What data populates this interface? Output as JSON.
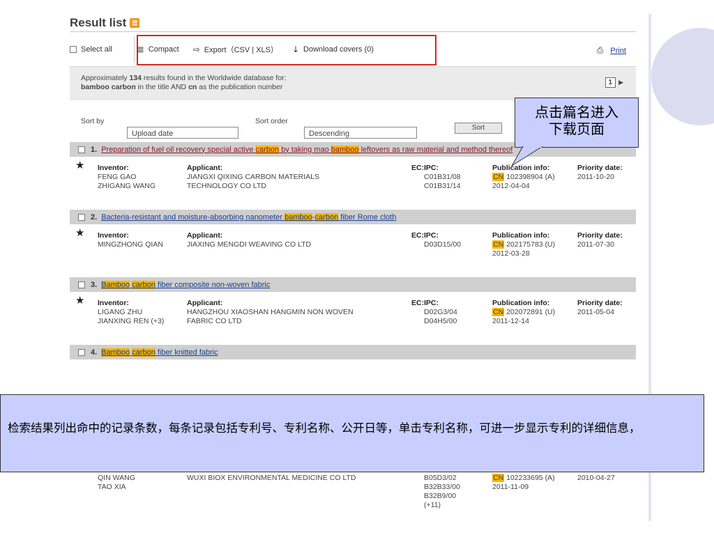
{
  "header": {
    "title": "Result list",
    "rss_icon": "rss-icon"
  },
  "toolbar": {
    "select_all": "Select all",
    "compact": "Compact",
    "export": "Export（CSV | XLS）",
    "download_covers": "Download covers (0)",
    "print": "Print"
  },
  "info": {
    "line1_pre": "Approximately ",
    "count": "134",
    "line1_post": " results found in the Worldwide database for:",
    "line2_term1": "bamboo carbon",
    "line2_mid": " in the title AND ",
    "line2_term2": "cn",
    "line2_post": " as the publication number",
    "page": "1"
  },
  "sort": {
    "sort_by_label": "Sort by",
    "sort_by_value": "Upload date",
    "sort_order_label": "Sort order",
    "sort_order_value": "Descending",
    "sort_button": "Sort"
  },
  "callout": {
    "line1": "点击篇名进入",
    "line2": "下载页面"
  },
  "labels": {
    "inventor": "Inventor:",
    "applicant": "Applicant:",
    "ec": "EC:",
    "ipc": "IPC:",
    "publication": "Publication info:",
    "priority": "Priority date:"
  },
  "results": [
    {
      "num": "1.",
      "title_a": "Preparation of fuel oil recovery special active ",
      "title_b": "carbon",
      "title_c": " by taking mao ",
      "title_d": "bamboo",
      "title_e": " leftovers as raw material and method thereof",
      "inventor1": "FENG GAO",
      "inventor2": "ZHIGANG WANG",
      "applicant1": "JIANGXI QIXING CARBON MATERIALS",
      "applicant2": "TECHNOLOGY CO LTD",
      "ipc1": "C01B31/08",
      "ipc2": "C01B31/14",
      "pub_cn": "CN",
      "pub_no": " 102398904 (A)",
      "pub_date": "2012-04-04",
      "priority": "2011-10-20"
    },
    {
      "num": "2.",
      "title_a": "Bacteria-resistant and moisture-absorbing nanometer ",
      "title_b": "bamboo",
      "title_c": "-",
      "title_d": "carbon",
      "title_e": " fiber Rome cloth",
      "inventor1": "MINGZHONG QIAN",
      "inventor2": "",
      "applicant1": "JIAXING MENGDI WEAVING CO LTD",
      "applicant2": "",
      "ipc1": "D03D15/00",
      "ipc2": "",
      "pub_cn": "CN",
      "pub_no": " 202175783 (U)",
      "pub_date": "2012-03-28",
      "priority": "2011-07-30"
    },
    {
      "num": "3.",
      "title_a": "",
      "title_b": "Bamboo",
      "title_c": " ",
      "title_d": "carbon",
      "title_e": " fiber composite non-woven fabric",
      "inventor1": "LIGANG ZHU",
      "inventor2": "JIANXING REN (+3)",
      "applicant1": "HANGZHOU XIAOSHAN HANGMIN NON WOVEN",
      "applicant2": "FABRIC CO LTD",
      "ipc1": "D02G3/04",
      "ipc2": "D04H5/00",
      "pub_cn": "CN",
      "pub_no": " 202072891 (U)",
      "pub_date": "2011-12-14",
      "priority": "2011-05-04"
    },
    {
      "num": "4.",
      "title_a": "",
      "title_b": "Bamboo",
      "title_c": " ",
      "title_d": "carbon",
      "title_e": " fiber knitted fabric"
    }
  ],
  "overlay": {
    "text": "检索结果列出命中的记录条数，每条记录包括专利号、专利名称、公开日等，单击专利名称，可进一步显示专利的详细信息，"
  },
  "bottom": {
    "inventor1": "QIN WANG",
    "inventor2": "TAO XIA",
    "applicant": "WUXI BIOX ENVIRONMENTAL MEDICINE CO LTD",
    "ipc1": "B05D3/02",
    "ipc2": "B32B33/00",
    "ipc3": "B32B9/00",
    "ipc4": "(+11)",
    "pub_cn": "CN",
    "pub_no": " 102233695 (A)",
    "pub_date": "2011-11-09",
    "priority": "2010-04-27"
  },
  "colors": {
    "highlight": "#f7b500",
    "callout_bg": "#c8cfff",
    "red_box": "#e02020",
    "link": "#1a3f91"
  }
}
